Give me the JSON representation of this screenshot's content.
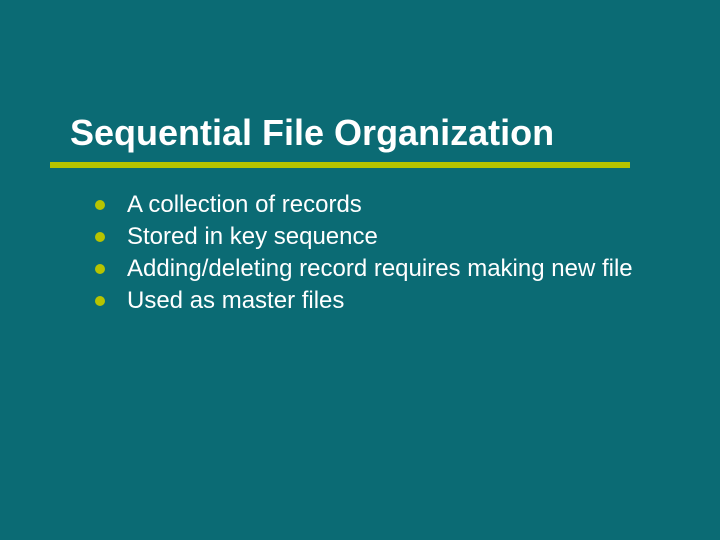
{
  "slide": {
    "title": "Sequential File Organization",
    "bullets": [
      "A collection of records",
      "Stored in key sequence",
      "Adding/deleting record requires making new file",
      "Used as master files"
    ]
  }
}
